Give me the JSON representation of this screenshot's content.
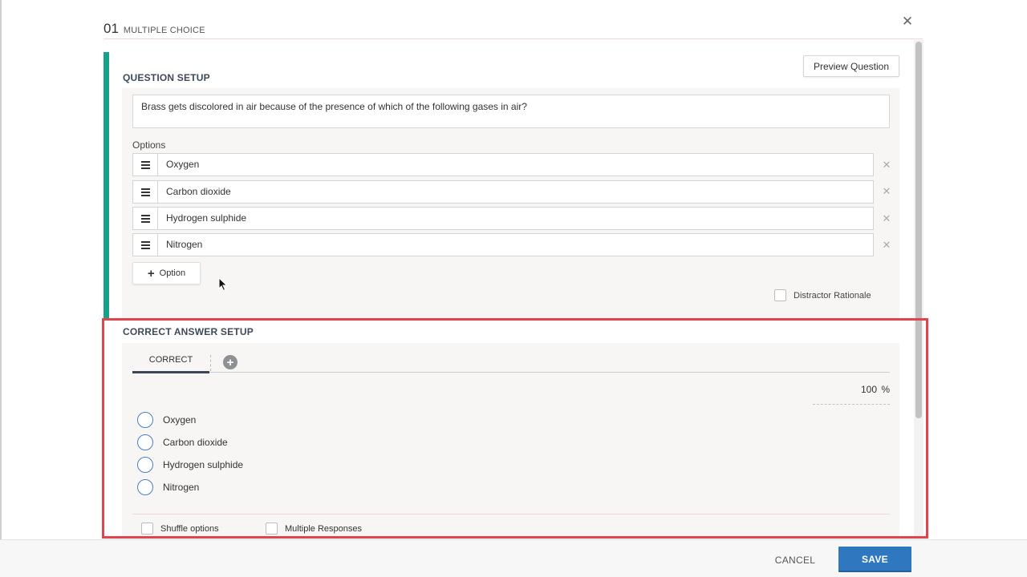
{
  "header": {
    "question_number": "01",
    "question_type": "MULTIPLE CHOICE",
    "close_icon": "close-icon"
  },
  "question_setup": {
    "title": "QUESTION SETUP",
    "preview_button": "Preview Question",
    "stem": "Brass gets discolored in air because of the presence of which of the following gases in air?",
    "options_label": "Options",
    "options": [
      "Oxygen",
      "Carbon dioxide",
      "Hydrogen sulphide",
      "Nitrogen"
    ],
    "add_option_label": "Option",
    "distractor_rationale_label": "Distractor Rationale",
    "distractor_rationale_checked": false
  },
  "correct_answer_setup": {
    "title": "CORRECT ANSWER SETUP",
    "tab_label": "CORRECT",
    "score_value": "100",
    "score_unit": "%",
    "answers": [
      "Oxygen",
      "Carbon dioxide",
      "Hydrogen sulphide",
      "Nitrogen"
    ],
    "shuffle_label": "Shuffle options",
    "shuffle_checked": false,
    "multiple_responses_label": "Multiple Responses",
    "multiple_responses_checked": false
  },
  "footer": {
    "cancel_label": "CANCEL",
    "save_label": "SAVE"
  },
  "colors": {
    "accent_teal": "#17a08a",
    "save_blue": "#2f78bf",
    "highlight_red": "#e0454f",
    "radio_blue": "#4a7fbf"
  }
}
